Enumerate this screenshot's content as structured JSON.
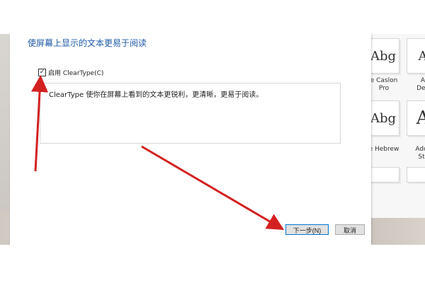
{
  "dialog": {
    "title": "使屏幕上显示的文本更易于阅读",
    "enable_cleartype_label": "启用 ClearType(C)",
    "enable_cleartype_checked": true,
    "check_mark": "✓",
    "description": "ClearType 使你在屏幕上看到的文本更锐利，更清晰，更易于阅读。",
    "next_button": "下一步(N)",
    "cancel_button": "取消"
  },
  "font_panel": {
    "tiles": [
      {
        "glyph": "Abg"
      },
      {
        "glyph": "A"
      },
      {
        "glyph": "Abg"
      },
      {
        "glyph": "A"
      }
    ],
    "labels": [
      {
        "line1": "e Caslon",
        "line2": "Pro"
      },
      {
        "line1": "A",
        "line2": "Dev"
      },
      {
        "line1": "e Hebrew",
        "line2": ""
      },
      {
        "line1": "Ado",
        "line2": "St"
      }
    ]
  },
  "annotation_color": "#d42020"
}
